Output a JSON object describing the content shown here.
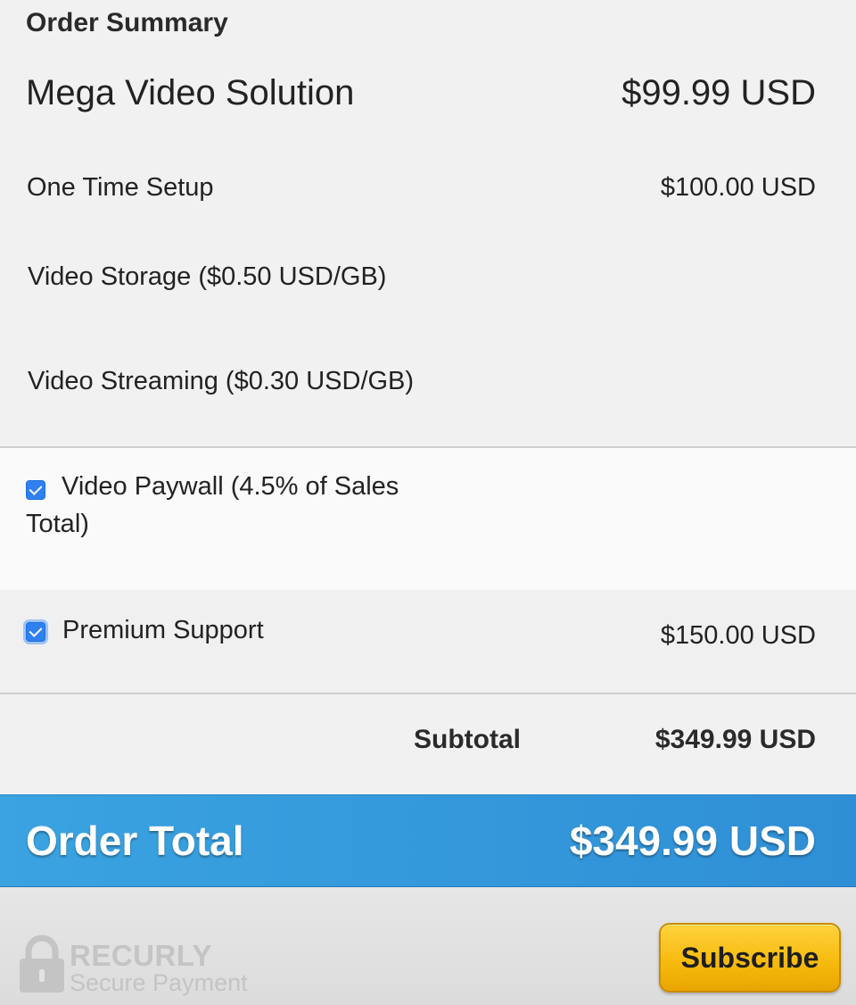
{
  "order": {
    "title": "Order Summary",
    "plan_name": "Mega Video Solution",
    "plan_price": "$99.99 USD",
    "setup_label": "One Time Setup",
    "setup_price": "$100.00 USD",
    "storage_label": "Video Storage ($0.50 USD/GB)",
    "streaming_label": "Video Streaming ($0.30 USD/GB)"
  },
  "addons": [
    {
      "label": "Video Paywall (4.5% of Sales",
      "label_line2": "Total)",
      "checked": true
    },
    {
      "label": "Premium Support",
      "price": "$150.00 USD",
      "checked": true
    }
  ],
  "subtotal": {
    "label": "Subtotal",
    "value": "$349.99 USD"
  },
  "total": {
    "label": "Order Total",
    "value": "$349.99 USD"
  },
  "footer": {
    "brand": "RECURLY",
    "brand_sub": "Secure Payment",
    "subscribe_label": "Subscribe"
  },
  "colors": {
    "accent_blue": "#3aa3e0",
    "checkbox_blue": "#2f80f0",
    "button_yellow": "#f6b90c"
  },
  "icons": {
    "lock": "lock-icon",
    "checkbox": "checkbox-checked-icon"
  }
}
